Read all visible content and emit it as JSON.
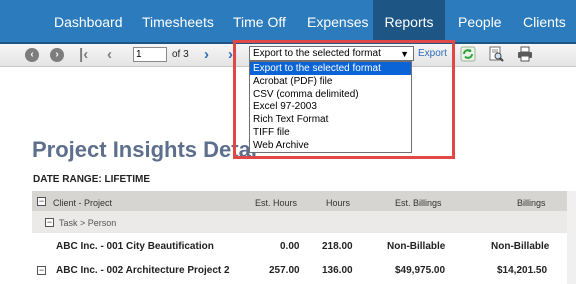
{
  "nav": {
    "items": [
      {
        "label": "Dashboard"
      },
      {
        "label": "Timesheets"
      },
      {
        "label": "Time Off"
      },
      {
        "label": "Expenses"
      },
      {
        "label": "Reports",
        "active": true
      },
      {
        "label": "People"
      },
      {
        "label": "Clients"
      }
    ],
    "colors": {
      "bar": "#2b7bbd",
      "active": "#1d5585"
    }
  },
  "toolbar": {
    "page_value": "1",
    "page_of": "of 3",
    "export_select_value": "Export to the selected format",
    "export_label": "Export",
    "icons": [
      "back-icon",
      "forward-icon",
      "first-page-icon",
      "previous-page-icon",
      "next-page-icon",
      "last-page-icon",
      "refresh-icon",
      "print-preview-icon",
      "print-icon"
    ]
  },
  "export_dropdown": {
    "options": [
      "Export to the selected format",
      "Acrobat (PDF) file",
      "CSV (comma delimited)",
      "Excel 97-2003",
      "Rich Text Format",
      "TIFF file",
      "Web Archive"
    ],
    "selected_index": 0,
    "highlight_color": "#e04848"
  },
  "report": {
    "title": "Project Insights Detai",
    "date_range": "DATE RANGE: LIFETIME",
    "columns": [
      "Client - Project",
      "Est. Hours",
      "Hours",
      "Est. Billings",
      "Billings"
    ],
    "group_row": "Task > Person",
    "rows": [
      {
        "name": "ABC Inc. - 001 City Beautification",
        "est_hours": "0.00",
        "hours": "218.00",
        "est_billings": "Non-Billable",
        "billings": "Non-Billable"
      },
      {
        "name": "ABC Inc. - 002 Architecture Project 2",
        "est_hours": "257.00",
        "hours": "136.00",
        "est_billings": "$49,975.00",
        "billings": "$14,201.50"
      }
    ]
  }
}
